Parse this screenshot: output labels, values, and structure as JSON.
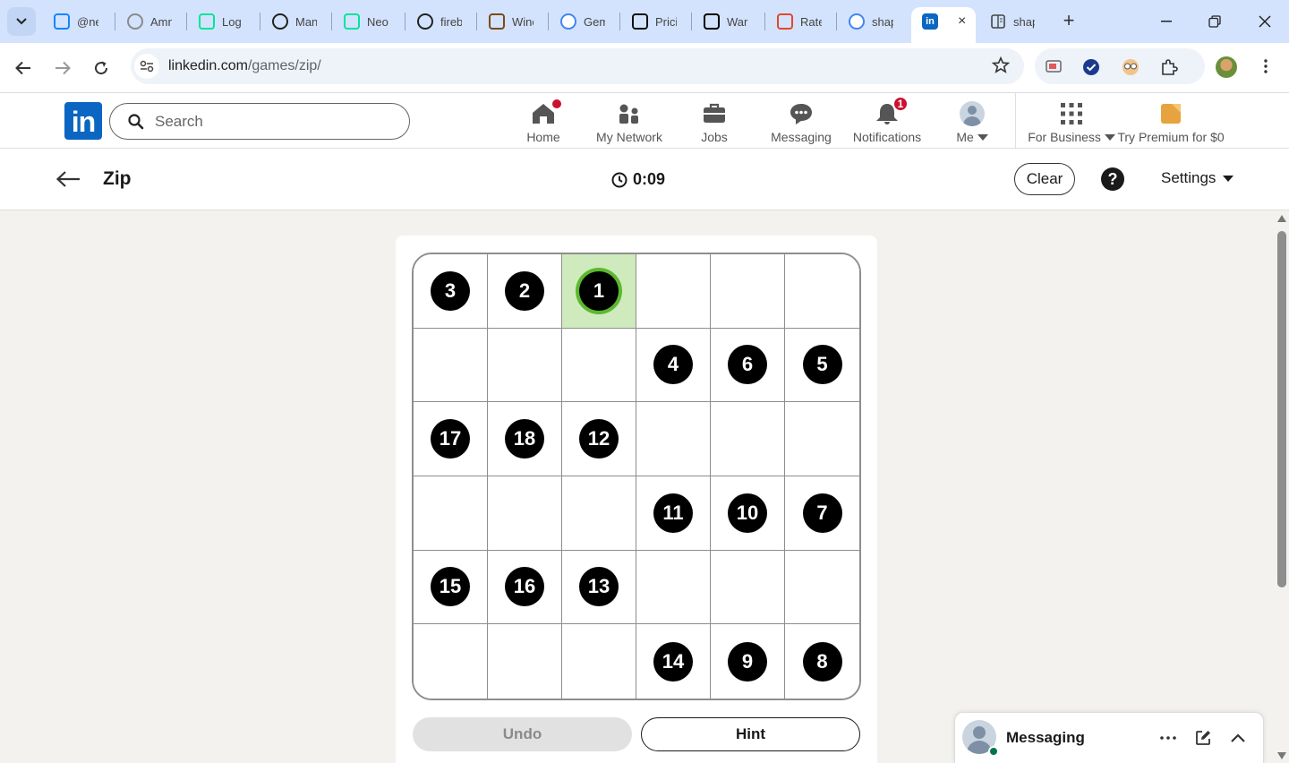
{
  "browser": {
    "tabs": [
      {
        "title": "@ne",
        "icon": "bluesky-icon",
        "color": "#1185fe"
      },
      {
        "title": "Amn",
        "icon": "loading-circle-icon",
        "color": "#8a8a8a"
      },
      {
        "title": "Log",
        "icon": "neon-logo-icon",
        "color": "#00e599"
      },
      {
        "title": "Man",
        "icon": "circle-n-icon",
        "color": "#222222"
      },
      {
        "title": "Neo",
        "icon": "neon-logo-icon",
        "color": "#00e599"
      },
      {
        "title": "fireb",
        "icon": "github-icon",
        "color": "#222222"
      },
      {
        "title": "Winc",
        "icon": "dog-icon",
        "color": "#7a4a1a"
      },
      {
        "title": "Gem",
        "icon": "google-icon",
        "color": "#4285f4"
      },
      {
        "title": "Pricin",
        "icon": "w-logo-icon",
        "color": "#111111"
      },
      {
        "title": "Warp",
        "icon": "warp-icon",
        "color": "#000000"
      },
      {
        "title": "Rate",
        "icon": "m-logo-icon",
        "color": "#e2472f"
      },
      {
        "title": "shap",
        "icon": "google-icon",
        "color": "#4285f4"
      }
    ],
    "active_tab": {
      "icon": "linkedin-icon",
      "close": "×"
    },
    "last_tab": {
      "title": "shap",
      "icon": "reader-icon"
    },
    "new_tab_label": "+",
    "url_host": "linkedin.com",
    "url_path": "/games/zip/"
  },
  "linkedin": {
    "logo_text": "in",
    "search_placeholder": "Search",
    "nav": [
      {
        "label": "Home",
        "icon": "home-icon"
      },
      {
        "label": "My Network",
        "icon": "network-icon"
      },
      {
        "label": "Jobs",
        "icon": "briefcase-icon"
      },
      {
        "label": "Messaging",
        "icon": "chat-icon"
      },
      {
        "label": "Notifications",
        "icon": "bell-icon",
        "badge": "1"
      },
      {
        "label": "Me",
        "icon": "avatar"
      }
    ],
    "business_label": "For Business",
    "premium_label": "Try Premium for $0",
    "brand_color": "#0a66c2",
    "badge_color": "#cb112d"
  },
  "game": {
    "title": "Zip",
    "timer": "0:09",
    "clear_label": "Clear",
    "help_label": "?",
    "settings_label": "Settings",
    "undo_label": "Undo",
    "hint_label": "Hint",
    "grid": [
      [
        "3",
        "2",
        "1",
        "",
        "",
        ""
      ],
      [
        "",
        "",
        "",
        "4",
        "6",
        "5"
      ],
      [
        "17",
        "18",
        "12",
        "",
        "",
        ""
      ],
      [
        "",
        "",
        "",
        "11",
        "10",
        "7"
      ],
      [
        "15",
        "16",
        "13",
        "",
        "",
        ""
      ],
      [
        "",
        "",
        "",
        "14",
        "9",
        "8"
      ]
    ],
    "active_cell": {
      "row": 0,
      "col": 2
    },
    "active_color": "#cfeabc",
    "active_ring_color": "#5cb82e"
  },
  "messaging_dock": {
    "label": "Messaging",
    "more_icon": "ellipsis-icon",
    "compose_icon": "compose-icon",
    "collapse_icon": "chevron-up-icon"
  }
}
